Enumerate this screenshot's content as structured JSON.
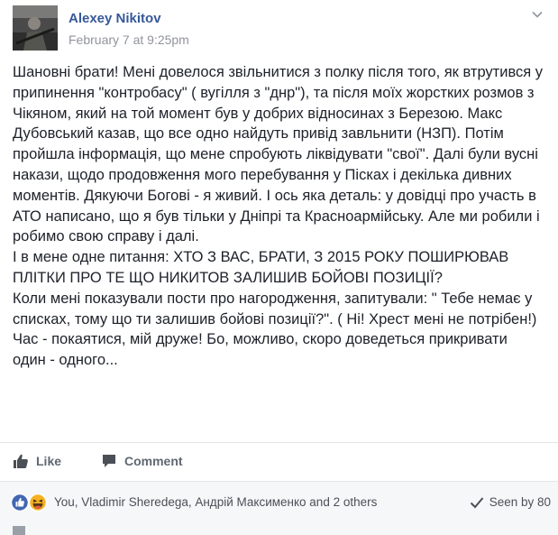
{
  "post": {
    "author": "Alexey Nikitov",
    "timestamp": "February 7 at 9:25pm",
    "paragraphs": [
      "Шановні брати! Мені довелося звільнитися з полку після того, як втрутився у припинення \"контробасу\" ( вугілля з \"днр\"), та після моїх жорстких розмов з Чікяном, який на той момент був у добрих відносинах з Березою. Макс Дубовський казав, що все одно найдуть привід завльнити (НЗП). Потім пройшла інформація, що мене спробують ліквідувати \"свої\". Далі були вусні накази, щодо продовження мого перебування у Пісках і декілька дивних моментів. Дякуючи Богові - я живий. І ось яка деталь: у довідці про участь в АТО написано, що я був тільки у Дніпрі та Красноармійську. Але ми робили і робимо свою справу і далі.",
      "І в мене одне питання: ХТО З ВАС, БРАТИ, З 2015 РОКУ ПОШИРЮВАВ ПЛІТКИ ПРО ТЕ ЩО НИКИТОВ ЗАЛИШИВ БОЙОВІ ПОЗИЦІЇ?",
      "Коли мені показували пости про нагородження, запитували: \" Тебе немає у списках, тому що ти залишив бойові позиції?\". ( Ні! Хрест мені не потрібен!)",
      "Час - покаятися, мій друже! Бо, можливо, скоро доведеться прикривати один - одного..."
    ]
  },
  "actions": {
    "like_label": "Like",
    "comment_label": "Comment"
  },
  "summary": {
    "reactors_text": "You, Vladimir Sheredega, Андрій Максименко and 2 others",
    "seen_text": "Seen by 80",
    "reaction_icons": [
      "like-reaction-icon",
      "haha-reaction-icon"
    ]
  },
  "colors": {
    "link": "#365899",
    "meta": "#90949c",
    "like_blue": "#4267b2",
    "haha_yellow": "#f7b125"
  }
}
